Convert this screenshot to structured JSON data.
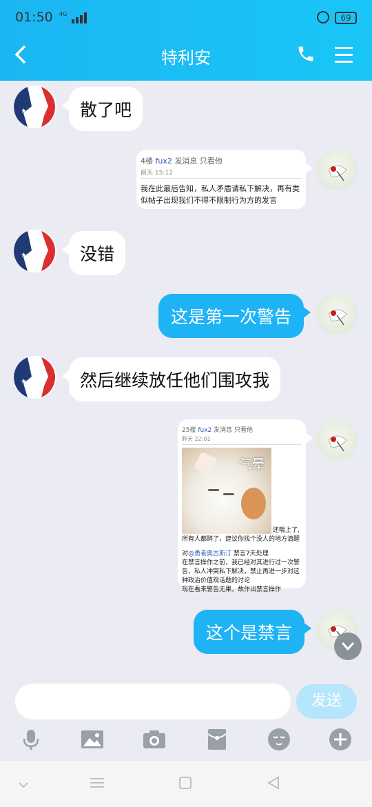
{
  "status_bar": {
    "time": "01:50",
    "network": "4G",
    "battery": "69"
  },
  "header": {
    "title": "特利安",
    "back_icon": "back-arrow-icon",
    "phone_icon": "phone-icon",
    "menu_icon": "menu-icon"
  },
  "messages": [
    {
      "side": "left",
      "type": "text",
      "text": "散了吧"
    },
    {
      "side": "right",
      "type": "card",
      "floor": "4楼",
      "user": "fux2",
      "actions": "发消息 只看他",
      "time": "前天 15:12",
      "body": "我在此最后告知，私人矛盾请私下解决，再有类似帖子出现我们不得不限制行为方的发言"
    },
    {
      "side": "left",
      "type": "text",
      "text": "没错"
    },
    {
      "side": "right",
      "type": "text",
      "text": "这是第一次警告"
    },
    {
      "side": "left",
      "type": "text",
      "text": "然后继续放任他们围攻我"
    },
    {
      "side": "right",
      "type": "card_image",
      "floor": "25楼",
      "user": "fux2",
      "actions": "发消息 只看他",
      "time": "昨天 22:01",
      "image_caption": "气晕",
      "after_image": "还喘上了,",
      "line2": "所有人都醉了，建议你找个没人的地方清醒",
      "mention_prefix": "对",
      "mention": "@勇者奥古斯汀",
      "mention_suffix": " 禁言7天处理",
      "line3": "在禁言操作之前，我已经对其进行过一次警告，私人冲突私下解决，禁止再进一步对这种政治价值观话题的讨论",
      "line4": "现在看来警告无果，故作出禁言操作"
    },
    {
      "side": "right",
      "type": "text",
      "text": "这个是禁言"
    }
  ],
  "input": {
    "placeholder": "",
    "send_label": "发送"
  },
  "toolbar": [
    "microphone-icon",
    "image-icon",
    "camera-icon",
    "red-packet-icon",
    "emoji-icon",
    "plus-icon"
  ],
  "colors": {
    "header": "#1ab6f3",
    "bubble_self": "#1eb3f5",
    "bubble_other": "#ffffff",
    "send_disabled": "#b6e6fb"
  }
}
